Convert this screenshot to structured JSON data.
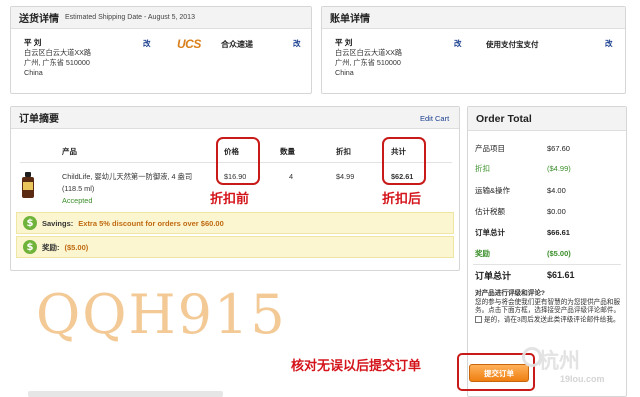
{
  "shipping": {
    "title": "送货详情",
    "subtitle": "Estimated Shipping Date - August 5, 2013",
    "name": "平 刘",
    "addr1": "白云区白云大道XX路",
    "addr2": "广州, 广东省 510000",
    "country": "China",
    "edit": "改",
    "carrier_logo": "UCS",
    "carrier_name": "合众速递",
    "carrier_edit": "改"
  },
  "billing": {
    "title": "账单详情",
    "name": "平 刘",
    "addr1": "白云区白云大道XX路",
    "addr2": "广州, 广东省 510000",
    "country": "China",
    "edit": "改",
    "payment": "使用支付宝支付",
    "payment_edit": "改"
  },
  "order_summary": {
    "title": "订单摘要",
    "edit_cart": "Edit Cart",
    "headers": {
      "product": "产品",
      "price": "价格",
      "qty": "数量",
      "discount": "折扣",
      "total": "共计"
    },
    "item": {
      "name1": "ChildLife, 婴幼儿天然第一防御液, 4 盎司",
      "name2": "(118.5 ml)",
      "status": "Accepted",
      "price": "$16.90",
      "qty": "4",
      "discount": "$4.99",
      "total": "$62.61"
    },
    "savings_label": "Savings:",
    "savings_text": "Extra 5% discount for orders over $60.00",
    "reward_label": "奖励:",
    "reward_value": "($5.00)"
  },
  "annotations": {
    "before_discount": "折扣前",
    "after_discount": "折扣后",
    "confirm_note": "核对无误以后提交订单",
    "watermark": "QQH915"
  },
  "order_total": {
    "title": "Order Total",
    "rows": [
      {
        "label": "产品项目",
        "value": "$67.60"
      },
      {
        "label": "折扣",
        "value": "($4.99)"
      },
      {
        "label": "运输&操作",
        "value": "$4.00"
      },
      {
        "label": "估计税额",
        "value": "$0.00"
      },
      {
        "label": "订单总计",
        "value": "$66.61"
      },
      {
        "label": "奖励",
        "value": "($5.00)"
      }
    ],
    "final_label": "订单总计",
    "final_value": "$61.61",
    "comment_title": "对产品进行评级和评论?",
    "comment_text": "您的参与将会使我们更有智慧的为您提供产品和服务。点击下面方框，选择接受产品评级评论邮件。",
    "comment_checkbox": "是的，请在3周后发送此类评级评论邮件给我。",
    "submit": "提交订单"
  },
  "site_watermark": {
    "text": "杭州",
    "small": "19lou.com"
  },
  "colors": {
    "annotation_red": "#c91a1a",
    "accent_orange": "#ef7f12",
    "accepted_green": "#3b8f2a"
  }
}
